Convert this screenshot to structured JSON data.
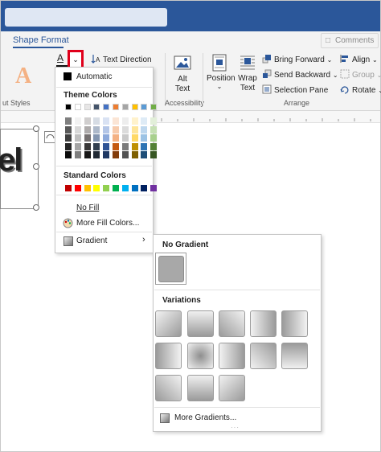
{
  "ribbon": {
    "tab_active": "Shape Format",
    "comments": "Comments",
    "styles_group": "ut Styles",
    "text_direction": "Text Direction",
    "alt_text": "Alt Text",
    "accessibility": "Accessibility",
    "position": "Position",
    "wrap_text": "Wrap Text",
    "bring_forward": "Bring Forward",
    "send_backward": "Send Backward",
    "selection_pane": "Selection Pane",
    "arrange": "Arrange",
    "align": "Align",
    "group": "Group",
    "rotate": "Rotate"
  },
  "document": {
    "shape_text": "el"
  },
  "text_fill_menu": {
    "automatic": "Automatic",
    "theme_colors": "Theme Colors",
    "standard_colors": "Standard Colors",
    "no_fill": "No Fill",
    "more_fill_colors": "More Fill Colors...",
    "gradient": "Gradient",
    "theme_top_row": [
      "#000000",
      "#ffffff",
      "#e7e6e6",
      "#44546a",
      "#4472c4",
      "#ed7d31",
      "#a5a5a5",
      "#ffc000",
      "#5b9bd5",
      "#70ad47"
    ],
    "theme_shades": [
      [
        "#7f7f7f",
        "#f2f2f2",
        "#d0cece",
        "#d6dce4",
        "#d9e2f3",
        "#fbe5d5",
        "#ededed",
        "#fff2cc",
        "#deebf6",
        "#e2efd9"
      ],
      [
        "#595959",
        "#d8d8d8",
        "#aeabab",
        "#adb9ca",
        "#b4c6e7",
        "#f7cbac",
        "#dbdbdb",
        "#fee599",
        "#bdd7ee",
        "#c5e0b3"
      ],
      [
        "#3f3f3f",
        "#bfbfbf",
        "#757070",
        "#8496b0",
        "#8eaadb",
        "#f4b183",
        "#c9c9c9",
        "#ffd965",
        "#9cc3e5",
        "#a8d08d"
      ],
      [
        "#262626",
        "#a5a5a5",
        "#3a3838",
        "#323f4f",
        "#2f5496",
        "#c55a11",
        "#7b7b7b",
        "#bf9000",
        "#2e75b5",
        "#538135"
      ],
      [
        "#0c0c0c",
        "#7f7f7f",
        "#171616",
        "#222a35",
        "#1f3864",
        "#833c0b",
        "#525252",
        "#7f6000",
        "#1e4e79",
        "#375623"
      ]
    ],
    "standard_row": [
      "#c00000",
      "#ff0000",
      "#ffc000",
      "#ffff00",
      "#92d050",
      "#00b050",
      "#00b0f0",
      "#0070c0",
      "#002060",
      "#7030a0"
    ]
  },
  "gradient_gallery": {
    "no_gradient": "No Gradient",
    "variations": "Variations",
    "more_gradients": "More Gradients..."
  }
}
